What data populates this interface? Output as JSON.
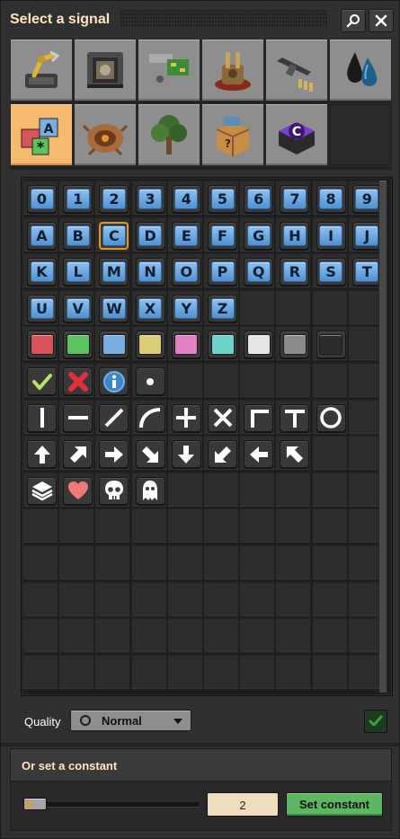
{
  "window": {
    "title": "Select a signal"
  },
  "titlebar": {
    "search_icon": "search-icon",
    "close_icon": "close-icon"
  },
  "tabs": [
    {
      "name": "tab-logistics",
      "icon": "inserter-icon"
    },
    {
      "name": "tab-production",
      "icon": "assembler-icon"
    },
    {
      "name": "tab-intermediate-products",
      "icon": "gears-circuit-icon"
    },
    {
      "name": "tab-combat-structures",
      "icon": "turret-icon"
    },
    {
      "name": "tab-combat",
      "icon": "rifle-ammo-icon"
    },
    {
      "name": "tab-fluids",
      "icon": "fluid-drops-icon"
    },
    {
      "name": "tab-signals",
      "icon": "signal-shapes-icon",
      "active": true
    },
    {
      "name": "tab-enemies",
      "icon": "biter-spawner-icon"
    },
    {
      "name": "tab-environment",
      "icon": "tree-icon"
    },
    {
      "name": "tab-unsorted",
      "icon": "mystery-box-icon"
    },
    {
      "name": "tab-constants",
      "icon": "constant-combinator-icon"
    }
  ],
  "signals": {
    "digits": [
      "0",
      "1",
      "2",
      "3",
      "4",
      "5",
      "6",
      "7",
      "8",
      "9"
    ],
    "letters": [
      "A",
      "B",
      "C",
      "D",
      "E",
      "F",
      "G",
      "H",
      "I",
      "J",
      "K",
      "L",
      "M",
      "N",
      "O",
      "P",
      "Q",
      "R",
      "S",
      "T",
      "U",
      "V",
      "W",
      "X",
      "Y",
      "Z"
    ],
    "selected": "C",
    "colors": [
      {
        "name": "signal-red",
        "color": "#d9535a"
      },
      {
        "name": "signal-green",
        "color": "#5cc15e"
      },
      {
        "name": "signal-blue",
        "color": "#79aee0"
      },
      {
        "name": "signal-yellow",
        "color": "#dccc78"
      },
      {
        "name": "signal-pink",
        "color": "#e082c4"
      },
      {
        "name": "signal-cyan",
        "color": "#69d3c9"
      },
      {
        "name": "signal-white",
        "color": "#e6e6e6"
      },
      {
        "name": "signal-grey",
        "color": "#8b8b8b"
      },
      {
        "name": "signal-black",
        "color": "#2b2b2b"
      }
    ],
    "status_icons": [
      "check-icon",
      "deny-icon",
      "info-icon",
      "dot-icon"
    ],
    "shape_icons": [
      "vertical-line-icon",
      "horizontal-line-icon",
      "diagonal-line-icon",
      "curve-icon",
      "plus-icon",
      "cross-icon",
      "corner-icon",
      "tee-icon",
      "circle-icon"
    ],
    "arrow_icons": [
      "arrow-up-icon",
      "arrow-up-right-icon",
      "arrow-right-icon",
      "arrow-down-right-icon",
      "arrow-down-icon",
      "arrow-down-left-icon",
      "arrow-left-icon",
      "arrow-up-left-icon"
    ],
    "misc_icons": [
      "stack-icon",
      "heart-icon",
      "skull-icon",
      "ghost-icon"
    ]
  },
  "quality": {
    "label": "Quality",
    "selected": "Normal",
    "icon": "quality-normal-icon"
  },
  "constant": {
    "title": "Or set a constant",
    "value": "2",
    "slider_fraction": 0.0,
    "button_label": "Set constant"
  }
}
